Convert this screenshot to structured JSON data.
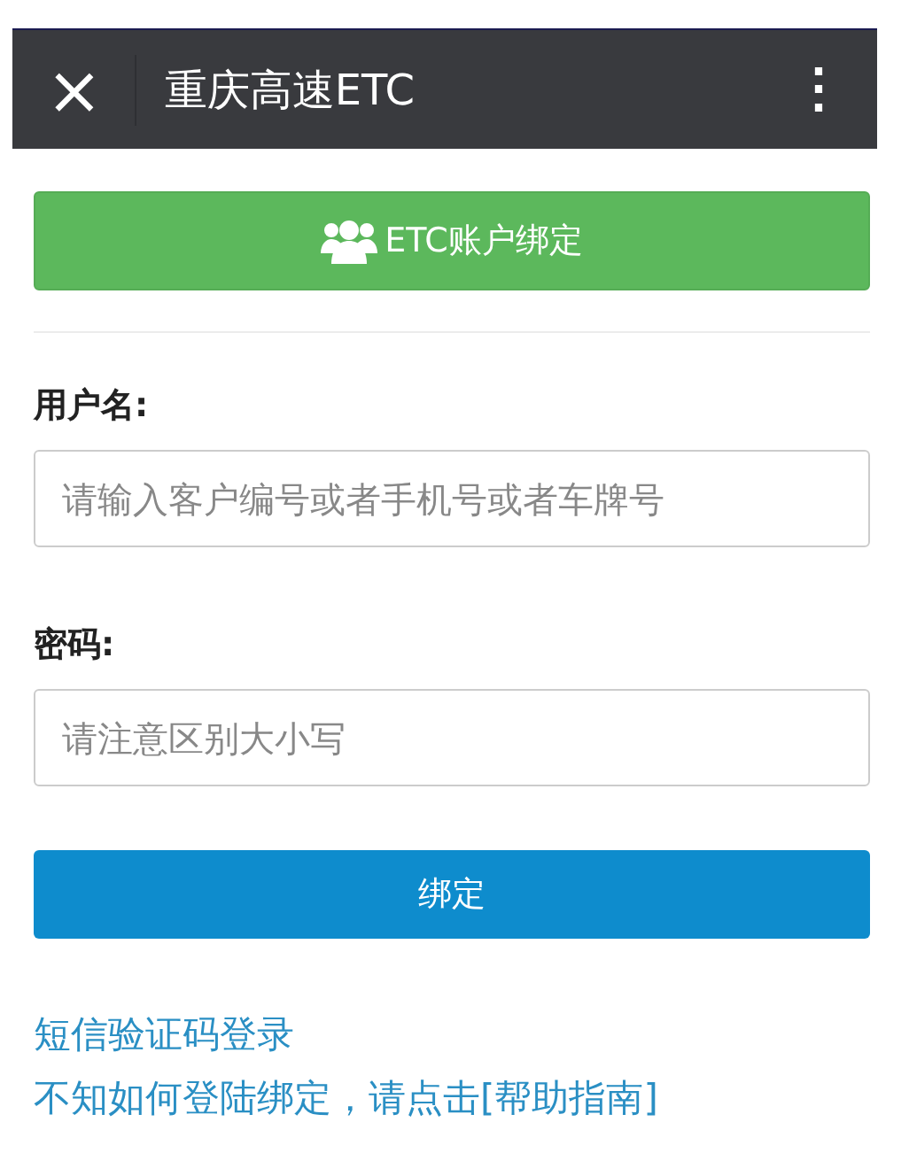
{
  "top_bar": {
    "close": "×",
    "title": "重庆高速ETC",
    "menu": "⋮"
  },
  "header_button": {
    "label": "ETC账户绑定"
  },
  "fields": [
    {
      "label": "用户名:",
      "placeholder": "请输入客户编号或者手机号或者车牌号"
    },
    {
      "label": "密码:",
      "placeholder": "请注意区别大小写"
    }
  ],
  "submit_button": {
    "label": "绑定"
  },
  "links": [
    "短信验证码登录",
    "不知如何登陆绑定，请点击[帮助指南]"
  ]
}
